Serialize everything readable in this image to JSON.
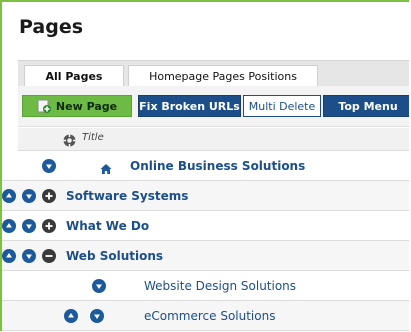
{
  "page": {
    "title": "Pages"
  },
  "tabs": [
    {
      "label": "All Pages",
      "active": true
    },
    {
      "label": "Homepage Pages Positions",
      "active": false
    }
  ],
  "toolbar": {
    "new_page": "New Page",
    "fix_broken_urls": "Fix Broken URLs",
    "multi_delete": "Multi Delete",
    "top_menu": "Top Menu"
  },
  "table": {
    "title_header": "Title",
    "rows": [
      {
        "label": "Online Business Solutions",
        "icons": [
          "arrow-down-icon",
          "home-icon"
        ]
      },
      {
        "label": "Software Systems",
        "icons": [
          "arrow-up-icon",
          "arrow-down-icon",
          "expand-plus-icon"
        ]
      },
      {
        "label": "What We Do",
        "icons": [
          "arrow-up-icon",
          "arrow-down-icon",
          "expand-plus-icon"
        ]
      },
      {
        "label": "Web Solutions",
        "icons": [
          "arrow-up-icon",
          "arrow-down-icon",
          "collapse-minus-icon"
        ]
      },
      {
        "label": "Website Design Solutions",
        "icons": [
          "arrow-down-icon"
        ]
      },
      {
        "label": "eCommerce Solutions",
        "icons": [
          "arrow-up-icon",
          "arrow-down-icon"
        ]
      }
    ]
  },
  "colors": {
    "accent_green": "#6dba44",
    "frame_green": "#7cc142",
    "button_blue": "#1c4f8a",
    "link_blue": "#1c4f8a"
  }
}
